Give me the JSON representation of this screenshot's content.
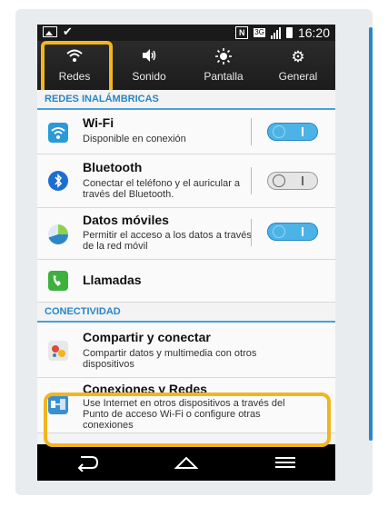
{
  "status_bar": {
    "time": "16:20",
    "network": "3G"
  },
  "quick_settings": [
    {
      "label": "Redes",
      "icon": "wifi-icon"
    },
    {
      "label": "Sonido",
      "icon": "speaker-icon"
    },
    {
      "label": "Pantalla",
      "icon": "brightness-icon"
    },
    {
      "label": "General",
      "icon": "gear-icon"
    }
  ],
  "sections": {
    "wireless_header": "REDES INALÁMBRICAS",
    "connectivity_header": "CONECTIVIDAD"
  },
  "items": {
    "wifi": {
      "title": "Wi-Fi",
      "desc": "Disponible en conexión",
      "toggle": "on"
    },
    "bluetooth": {
      "title": "Bluetooth",
      "desc": "Conectar el teléfono y el auricular a través del Bluetooth.",
      "toggle": "off"
    },
    "datos": {
      "title": "Datos móviles",
      "desc": "Permitir el acceso a los datos a través de la red móvil",
      "toggle": "on"
    },
    "llamadas": {
      "title": "Llamadas"
    },
    "compartir": {
      "title": "Compartir y conectar",
      "desc": "Compartir datos y multimedia con otros dispositivos"
    },
    "conexiones": {
      "title": "Conexiones y Redes",
      "desc": "Use Internet en otros dispositivos a través del Punto de acceso Wi-Fi o configure otras conexiones"
    }
  },
  "colors": {
    "accent": "#2a86c7",
    "highlight": "#f2b51f",
    "toggle_on": "#4cb3e6"
  }
}
